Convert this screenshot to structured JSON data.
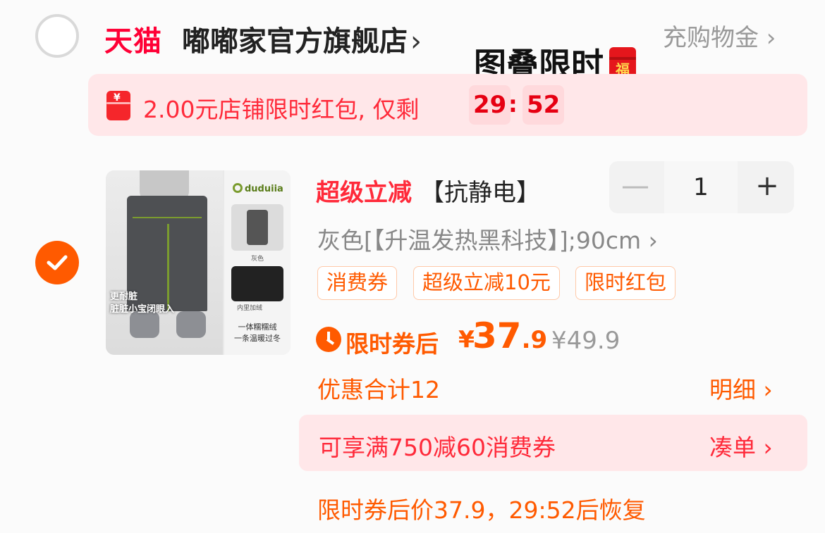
{
  "store": {
    "brand": "天猫",
    "name": "嘟嘟家官方旗舰店",
    "name_chevron": "›",
    "topup_label": "充购物金 ›"
  },
  "promo_overlay": {
    "title": "图叠限时",
    "icon": "red-envelope-fu-icon"
  },
  "red_packet": {
    "text": "2.00元店铺限时红包, 仅剩",
    "countdown_min": "29",
    "countdown_sep": ":",
    "countdown_sec": "52"
  },
  "item": {
    "selected": true,
    "title_highlight": "超级立减",
    "title_rest": "【抗静电】",
    "quantity": "1",
    "minus_label": "—",
    "plus_label": "+",
    "sku": "灰色[【升温发热黑科技】];90cm ›",
    "tags": [
      "消费券",
      "超级立减10元",
      "限时红包"
    ],
    "price_label": "限时券后",
    "currency": "¥",
    "price_int": "37",
    "price_dec": ".9",
    "original_price": "¥49.9",
    "discount_total": "优惠合计12",
    "detail_label": "明细 ›",
    "thumbnail": {
      "brand_logo": "duduiia",
      "caption_line1": "更耐脏",
      "caption_line2": "脏脏小宝闭眼入",
      "swatch1_label": "灰色",
      "swatch2_label": "内里加绒",
      "tagline1": "一体糯糯绒",
      "tagline2": "一条温暖过冬"
    }
  },
  "coupon": {
    "text": "可享满750减60消费券",
    "action": "凑单 ›"
  },
  "restore_note": "限时券后价37.9，29:52后恢复",
  "colors": {
    "tmall_red": "#ff0036",
    "accent_orange": "#ff5a00",
    "pink_bg": "#ffe7e9",
    "red_text": "#ff2a3a"
  }
}
